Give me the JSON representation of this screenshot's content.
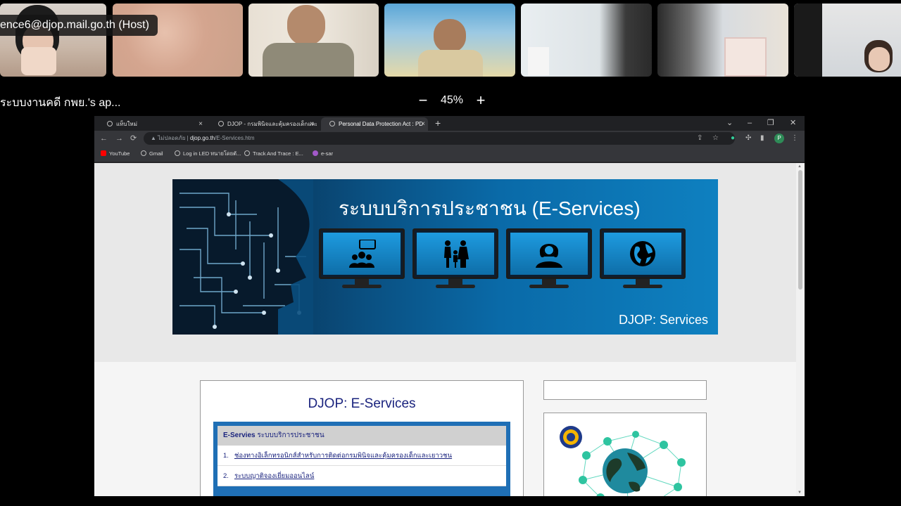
{
  "meeting": {
    "host_label": "ence6@djop.mail.go.th (Host)",
    "share_title": "ระบบงานคดี กพย.'s ap...",
    "zoom_level": "45%",
    "zoom_out_glyph": "−",
    "zoom_in_glyph": "+"
  },
  "browser": {
    "tabs": [
      {
        "label": "แท็บใหม่",
        "active": false
      },
      {
        "label": "DJOP - กรมพินิจและคุ้มครองเด็กและ...",
        "active": false
      },
      {
        "label": "Personal Data Protection Act : PD",
        "active": true
      }
    ],
    "tab_close_glyph": "×",
    "new_tab_glyph": "+",
    "window_controls": {
      "dropdown": "⌄",
      "minimize": "–",
      "restore": "❐",
      "close": "✕"
    },
    "nav": {
      "back": "←",
      "forward": "→",
      "reload": "⟳"
    },
    "omnibox": {
      "security_label": "ไม่ปลอดภัย",
      "host": "djop.go.th",
      "path": "/E-Services.htm"
    },
    "toolbar_icons": {
      "share": "⇪",
      "star": "☆",
      "extensions": "✣",
      "sidebar": "▮",
      "menu": "⋮"
    },
    "profile_initial": "P",
    "bookmarks": [
      {
        "label": "YouTube",
        "color": "#ff0000"
      },
      {
        "label": "Gmail",
        "color": "#bbbbbb"
      },
      {
        "label": "Log in LED ทนายโดยตั...",
        "color": "#bbbbbb"
      },
      {
        "label": "Track And Trace : E...",
        "color": "#bbbbbb"
      },
      {
        "label": "e-sar",
        "color": "#a259c9"
      }
    ]
  },
  "page": {
    "banner_title": "ระบบบริการประชาชน (E-Services)",
    "banner_subtitle": "DJOP: Services",
    "main_title": "DJOP: E-Services",
    "service_header_bold": "E-Servies",
    "service_header_rest": " ระบบบริการประชาชน",
    "service_items": [
      {
        "num": "1.",
        "label": "ช่องทางอิเล็กทรอนิกส์สำหรับการติดต่อกรมพินิจและคุ้มครองเด็กและเยาวชน"
      },
      {
        "num": "2.",
        "label": "ระบบญาติจองเยี่ยมออนไลน์"
      }
    ]
  },
  "colors": {
    "banner_blue": "#0a6aa8",
    "service_border": "#1f6fb5",
    "title_navy": "#1a237e"
  }
}
